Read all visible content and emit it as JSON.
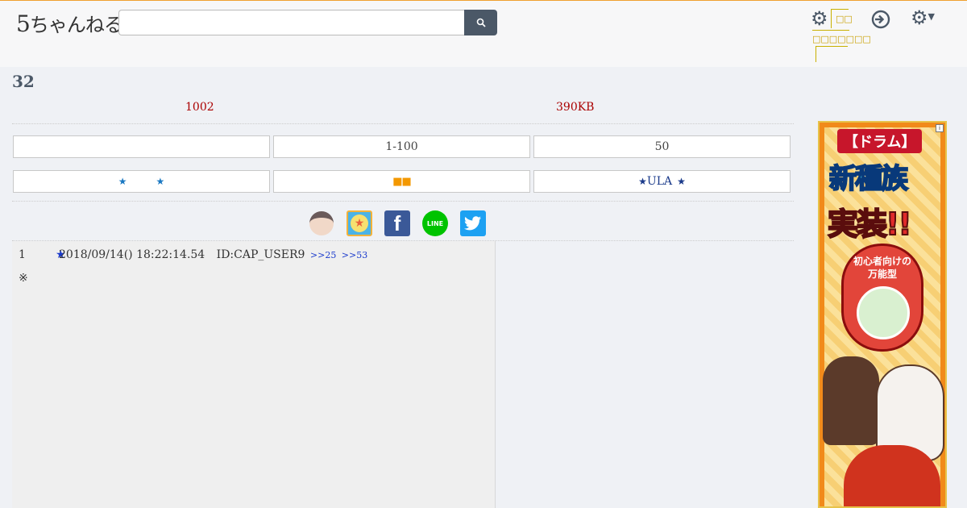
{
  "header": {
    "logo_num": "5",
    "logo_text": "ちゃんねる",
    "search": {
      "placeholder": "",
      "button_icon": "search-icon"
    },
    "icons": [
      "settings-gear-icon",
      "login-icon",
      "gear-dropdown-icon"
    ]
  },
  "thread": {
    "title": "32",
    "reply_count": "1002",
    "size": "390KB"
  },
  "nav_buttons": [
    {
      "label": ""
    },
    {
      "label": "1-100"
    },
    {
      "label": "50"
    }
  ],
  "action_buttons": [
    {
      "prefix": "★",
      "suffix": "★",
      "label": ""
    },
    {
      "label": "■■"
    },
    {
      "prefix": "★",
      "label": "ULA",
      "suffix": "★"
    }
  ],
  "share_icons": [
    "character-icon",
    "app-icon",
    "facebook-icon",
    "line-icon",
    "twitter-icon"
  ],
  "share_text": {
    "facebook": "f",
    "line": "LINE",
    "twitter": "🐦"
  },
  "post": {
    "number": "1",
    "star": "★",
    "datetime": "2018/09/14() 18:22:14.54",
    "id": "ID:CAP_USER9",
    "refs": [
      ">>25",
      ">>53"
    ],
    "mark": "※"
  },
  "ad": {
    "info": "i",
    "tag": "【ドラム】",
    "line1": "新種族",
    "line2": "実装!!",
    "badge_line1": "初心者向けの",
    "badge_line2": "万能型"
  },
  "colors": {
    "accent_dark": "#4b5867",
    "meta_red": "#aa0000",
    "star_blue": "#1a78c2",
    "orange": "#f39800"
  }
}
